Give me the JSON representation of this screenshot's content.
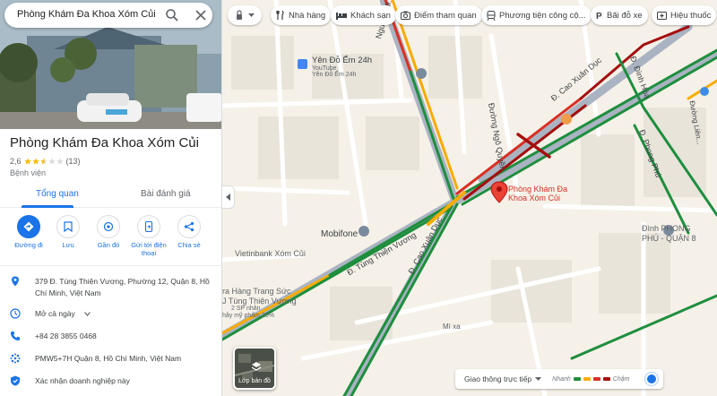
{
  "search": {
    "value": "Phòng Khám Đa Khoa Xóm Củi"
  },
  "place": {
    "name": "Phòng Khám Đa Khoa Xóm Củi",
    "rating": "2,6",
    "stars": 2.6,
    "review_count": "(13)",
    "category": "Bệnh viện"
  },
  "tabs": [
    {
      "label": "Tổng quan",
      "active": true
    },
    {
      "label": "Bài đánh giá",
      "active": false
    }
  ],
  "actions": [
    {
      "label": "Đường đi",
      "icon": "directions-icon"
    },
    {
      "label": "Lưu",
      "icon": "bookmark-icon"
    },
    {
      "label": "Gần đó",
      "icon": "nearby-icon"
    },
    {
      "label": "Gửi tới điện thoại",
      "icon": "send-to-phone-icon"
    },
    {
      "label": "Chia sẻ",
      "icon": "share-icon"
    }
  ],
  "info": {
    "address": "379 Đ. Tùng Thiện Vương, Phường 12, Quận 8, Hồ Chí Minh, Việt Nam",
    "hours": "Mở cả ngày",
    "phone": "+84 28 3855 0468",
    "plus_code": "PMW5+7H Quận 8, Hồ Chí Minh, Việt Nam",
    "claim": "Xác nhận doanh nghiệp này"
  },
  "chips": [
    {
      "label": "Nhà hàng",
      "icon": "restaurant-icon"
    },
    {
      "label": "Khách sạn",
      "icon": "hotel-icon"
    },
    {
      "label": "Điểm tham quan",
      "icon": "camera-icon"
    },
    {
      "label": "Phương tiện công cộ...",
      "icon": "transit-icon"
    },
    {
      "label": "Bãi đỗ xe",
      "icon": "parking-icon"
    },
    {
      "label": "Hiệu thuốc",
      "icon": "pharmacy-icon"
    }
  ],
  "map": {
    "pin_label_line1": "Phòng Khám Đa",
    "pin_label_line2": "Khoa Xóm Củi",
    "labels": {
      "yen_do": "Yên Đỗ Ếm 24h",
      "youtube": "YouTube",
      "yen_do_sub": "Yên Đỗ Ếm 24h",
      "mobifone": "Mobifone",
      "vietinbank": "Vietinbank Xóm Củi",
      "dinh": "Đình PHONG",
      "dinh2": "PHÚ - QUẬN 8",
      "hang_trang_suc": "ra Hàng Trang Sức",
      "tung_thien_vuong_shop": "J Tùng Thiện Vương",
      "sp_near": "2 SP nhân",
      "discount": "hây mỹ phẩm 25%",
      "mi_xa": "Mì xa",
      "nguyen_hien": "Nguyễn Hi...",
      "duong_ngo_quyen": "Đường Ngô Quyền",
      "cao_xuan_duc_top": "Đ. Cao Xuân Dục",
      "dinh_hoa": "Đ. Đình Hòa",
      "phong_phu": "Đ. Phong Phú",
      "tung_thien_vuong": "Đ. Tùng Thiện Vương",
      "cao_xuan_duc": "Đ. Cao Xuân Dục",
      "lien_tinh": "Đường Liên..."
    },
    "layers_label": "Lớp bản đồ",
    "traffic_select": "Giao thông trực tiếp",
    "traffic_fast": "Nhanh",
    "traffic_slow": "Chậm"
  },
  "colors": {
    "accent": "#1a73e8",
    "traffic_green": "#1e8e3e",
    "traffic_yellow": "#f9ab00",
    "traffic_red": "#d93025",
    "traffic_darkred": "#a50e0e"
  }
}
